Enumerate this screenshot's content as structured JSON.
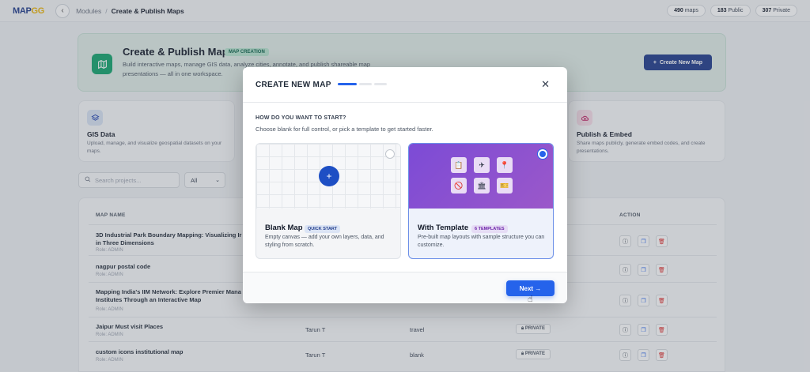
{
  "topbar": {
    "logo_main": "MAP",
    "logo_accent": "GG",
    "breadcrumb_parent": "Modules",
    "breadcrumb_sep": "/",
    "breadcrumb_current": "Create & Publish Maps",
    "stats": [
      {
        "value": "490",
        "label": "maps"
      },
      {
        "value": "183",
        "label": "Public"
      },
      {
        "value": "307",
        "label": "Private"
      }
    ]
  },
  "hero": {
    "title": "Create & Publish Maps",
    "tag": "MAP CREATION",
    "description": "Build interactive maps, manage GIS data, analyze cities, annotate, and publish shareable map presentations — all in one workspace.",
    "button_label": "Create New Map"
  },
  "cards": [
    {
      "title": "GIS Data",
      "description": "Upload, manage, and visualize geospatial datasets on your maps."
    },
    {
      "title": "Publish & Embed",
      "description": "Share maps publicly, generate embed codes, and create presentations."
    }
  ],
  "search": {
    "placeholder": "Search projects..."
  },
  "filter": {
    "value": "All"
  },
  "table": {
    "headers": {
      "name": "MAP NAME",
      "action": "ACTION"
    },
    "rows": [
      {
        "name": "3D Industrial Park Boundary Mapping: Visualizing Ir in Three Dimensions",
        "role": "Role: ADMIN",
        "owner": "",
        "category": "",
        "privacy": ""
      },
      {
        "name": "nagpur postal code",
        "role": "Role: ADMIN",
        "owner": "",
        "category": "",
        "privacy": ""
      },
      {
        "name": "Mapping India's IIM Network: Explore Premier Mana Institutes Through an Interactive Map",
        "role": "Role: ADMIN",
        "owner": "",
        "category": "",
        "privacy": ""
      },
      {
        "name": "Jaipur Must visit Places",
        "role": "Role: ADMIN",
        "owner": "Tarun T",
        "category": "travel",
        "privacy": "PRIVATE"
      },
      {
        "name": "custom icons institutional map",
        "role": "Role: ADMIN",
        "owner": "Tarun T",
        "category": "blank",
        "privacy": "PRIVATE"
      }
    ]
  },
  "modal": {
    "title": "CREATE NEW MAP",
    "question": "HOW DO YOU WANT TO START?",
    "subtitle": "Choose blank for full control, or pick a template to get started faster.",
    "step_current": 1,
    "step_total": 3,
    "options": [
      {
        "title": "Blank Map",
        "badge": "QUICK START",
        "description": "Empty canvas — add your own layers, data, and styling from scratch.",
        "selected": false
      },
      {
        "title": "With Template",
        "badge": "6 TEMPLATES",
        "description": "Pre-built map layouts with sample structure you can customize.",
        "selected": true
      }
    ],
    "next_label": "Next →"
  },
  "colors": {
    "primary": "#2563eb",
    "hero_button": "#1e3a8a",
    "hero_icon": "#10a36b",
    "template_gradient": "#7c4bd6"
  }
}
